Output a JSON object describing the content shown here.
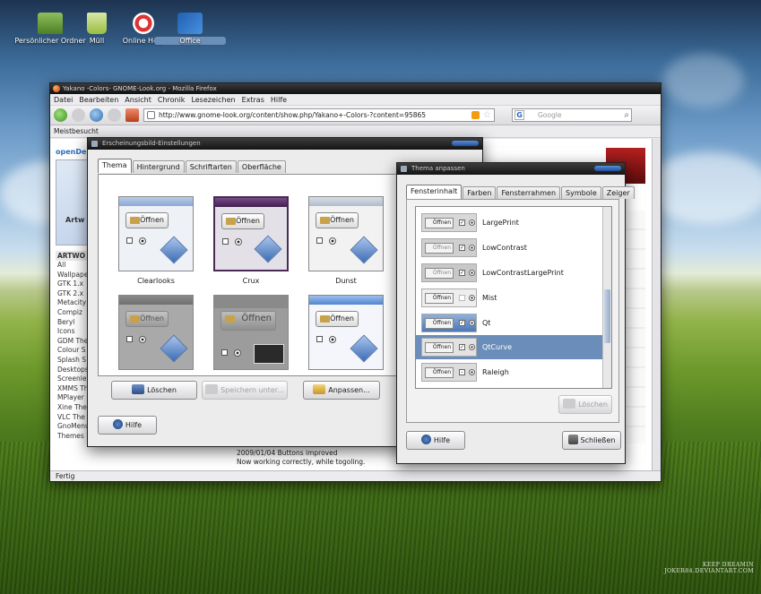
{
  "desktop": {
    "icons": [
      {
        "label": "Persönlicher Ordner",
        "icon": "folder-icon"
      },
      {
        "label": "Müll",
        "icon": "trash-icon"
      },
      {
        "label": "Online Help",
        "icon": "help-lifebuoy-icon"
      },
      {
        "label": "Office",
        "icon": "office-icon"
      }
    ],
    "watermark_line1": "KEEP DREAMIN",
    "watermark_line2": "JOKER84.DEVIANTART.COM"
  },
  "firefox": {
    "title": "Yakano -Colors- GNOME-Look.org - Mozilla Firefox",
    "menu": [
      "Datei",
      "Bearbeiten",
      "Ansicht",
      "Chronik",
      "Lesezeichen",
      "Extras",
      "Hilfe"
    ],
    "url": "http://www.gnome-look.org/content/show.php/Yakano+-Colors-?content=95865",
    "search_placeholder": "Google",
    "bookmarks_label": "Meistbesucht",
    "page": {
      "logo": "openDe",
      "banner_label": "Artw",
      "sidebar_header": "ARTWO",
      "sidebar_items": [
        "All",
        "Wallpape",
        "GTK 1.x",
        "GTK 2.x",
        "Metacity",
        "Compiz",
        "Beryl",
        "Icons",
        "GDM The",
        "Colour S",
        "Splash S",
        "Desktops",
        "Screenle",
        "XMMS Th",
        "MPlayer",
        "Xine The",
        "VLC The",
        "GnoMenu Themes"
      ],
      "news_line1": "2009/01/04 Buttons improved",
      "news_line2": "Now working correctly, while togoling."
    },
    "status": "Fertig"
  },
  "appearance": {
    "title": "Erscheinungsbild-Einstellungen",
    "tabs": [
      "Thema",
      "Hintergrund",
      "Schriftarten",
      "Oberfläche"
    ],
    "active_tab": "Thema",
    "preview_button_label": "Öffnen",
    "themes": [
      {
        "name": "Clearlooks"
      },
      {
        "name": "Crux"
      },
      {
        "name": "Dunst"
      },
      {
        "name": ""
      },
      {
        "name": ""
      },
      {
        "name": ""
      }
    ],
    "buttons": {
      "delete": "Löschen",
      "save_as": "Speichern unter...",
      "customize": "Anpassen...",
      "help": "Hilfe"
    }
  },
  "customize": {
    "title": "Thema anpassen",
    "tabs": [
      "Fensterinhalt",
      "Farben",
      "Fensterrahmen",
      "Symbole",
      "Zeiger"
    ],
    "active_tab": "Fensterinhalt",
    "preview_button_label": "Öffnen",
    "items": [
      {
        "name": "LargePrint",
        "selected": false
      },
      {
        "name": "LowContrast",
        "selected": false
      },
      {
        "name": "LowContrastLargePrint",
        "selected": false
      },
      {
        "name": "Mist",
        "selected": false
      },
      {
        "name": "Qt",
        "selected": false
      },
      {
        "name": "QtCurve",
        "selected": true
      },
      {
        "name": "Raleigh",
        "selected": false
      }
    ],
    "buttons": {
      "delete": "Löschen",
      "help": "Hilfe",
      "close": "Schließen"
    },
    "selection_color": "#6a8eb9"
  }
}
